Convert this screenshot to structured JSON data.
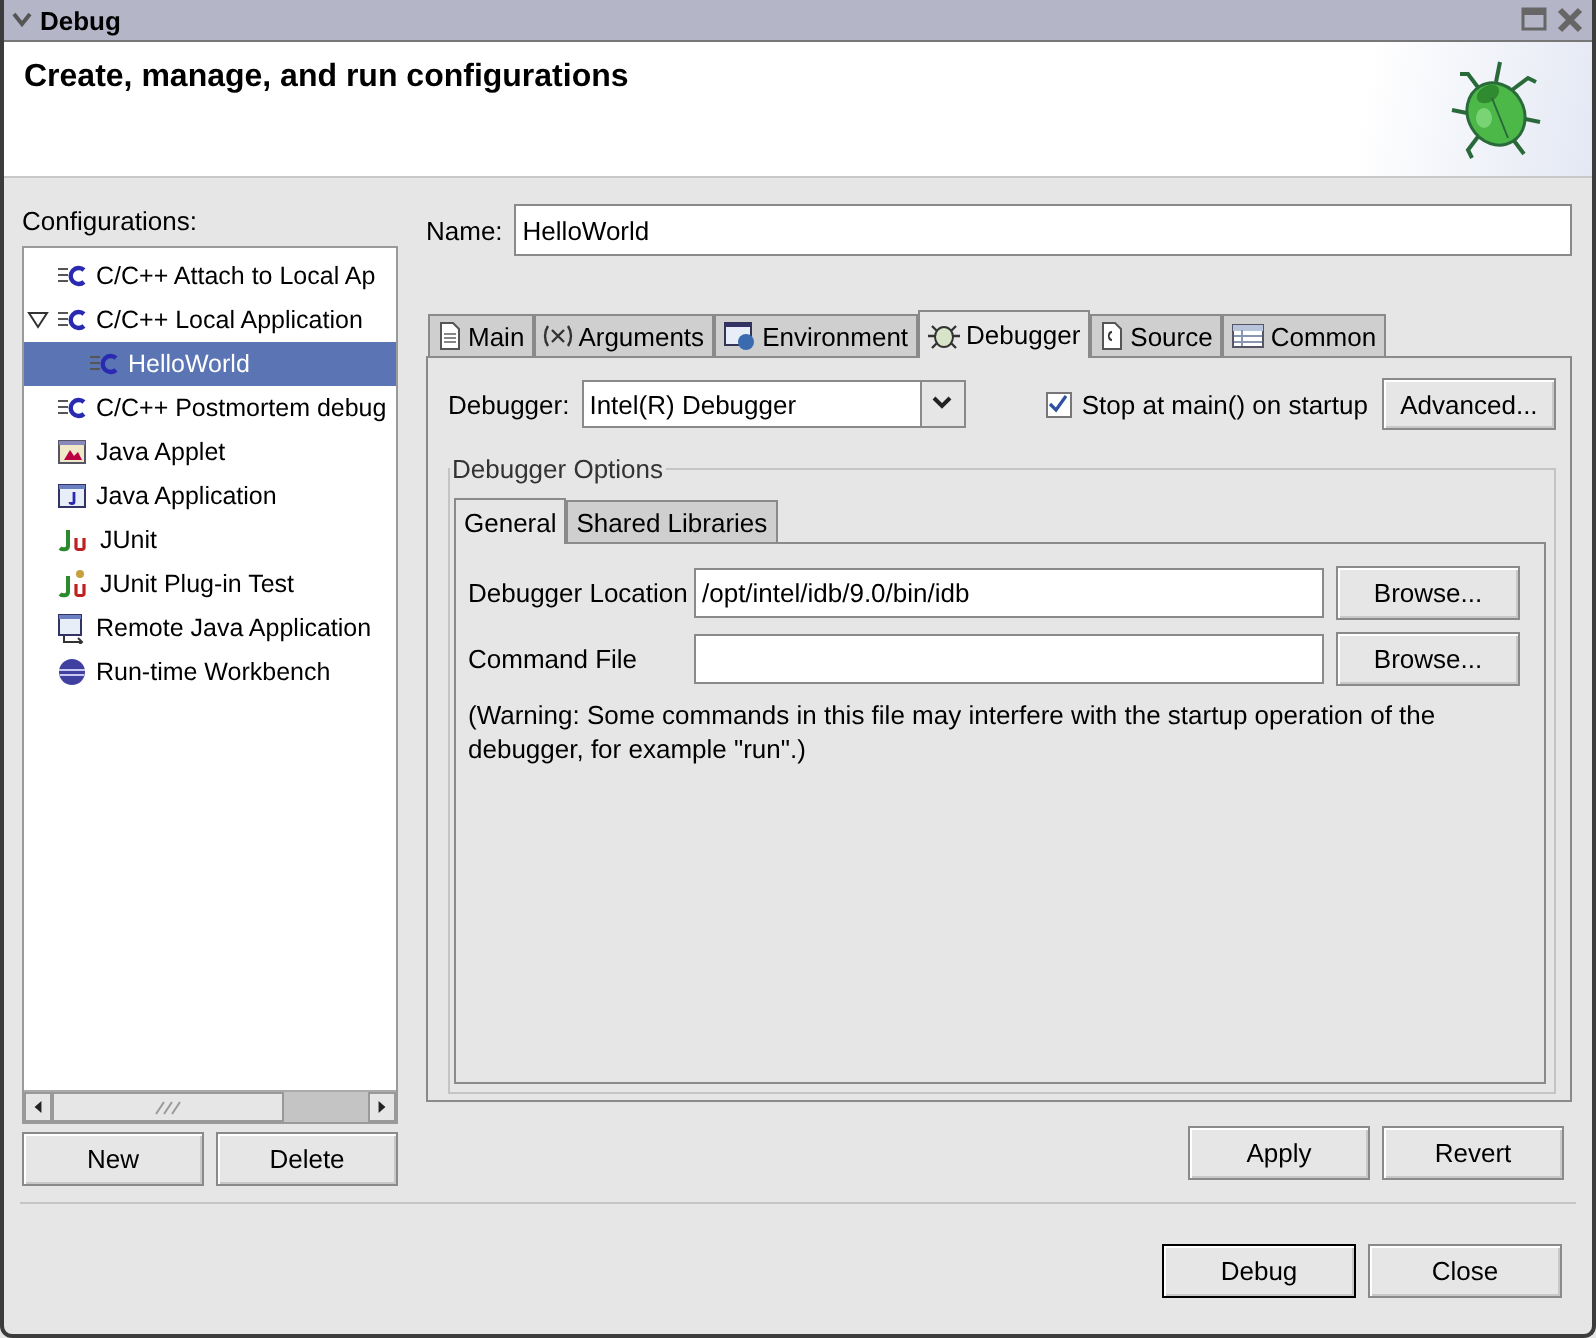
{
  "window": {
    "title": "Debug"
  },
  "header": {
    "title": "Create, manage, and run configurations"
  },
  "configurations": {
    "label": "Configurations:",
    "items": [
      {
        "label": "C/C++ Attach to Local Ap",
        "kind": "cpp",
        "selected": false
      },
      {
        "label": "C/C++ Local Application",
        "kind": "cpp",
        "selected": false,
        "expanded": true,
        "children": [
          {
            "label": "HelloWorld",
            "kind": "cpp",
            "selected": true
          }
        ]
      },
      {
        "label": "C/C++ Postmortem debug",
        "kind": "cpp",
        "selected": false
      },
      {
        "label": "Java Applet",
        "kind": "applet",
        "selected": false
      },
      {
        "label": "Java Application",
        "kind": "java",
        "selected": false
      },
      {
        "label": "JUnit",
        "kind": "junit",
        "selected": false
      },
      {
        "label": "JUnit Plug-in Test",
        "kind": "junit-plugin",
        "selected": false
      },
      {
        "label": "Remote Java Application",
        "kind": "remote",
        "selected": false
      },
      {
        "label": "Run-time Workbench",
        "kind": "workbench",
        "selected": false
      }
    ]
  },
  "config_buttons": [
    {
      "label": "New"
    },
    {
      "label": "Delete"
    }
  ],
  "name": {
    "label": "Name:",
    "value": "HelloWorld"
  },
  "tabs": [
    {
      "label": "Main",
      "kind": "main",
      "selected": false
    },
    {
      "label": "Arguments",
      "kind": "arguments",
      "selected": false
    },
    {
      "label": "Environment",
      "kind": "environment",
      "selected": false
    },
    {
      "label": "Debugger",
      "kind": "debugger",
      "selected": true
    },
    {
      "label": "Source",
      "kind": "source",
      "selected": false
    },
    {
      "label": "Common",
      "kind": "common",
      "selected": false
    }
  ],
  "debugger": {
    "label": "Debugger:",
    "value": "Intel(R) Debugger"
  },
  "stop_at_main": {
    "label": "Stop at main() on startup",
    "checked": true
  },
  "advanced_button": {
    "label": "Advanced..."
  },
  "options": {
    "title": "Debugger Options",
    "tabs": [
      {
        "label": "General",
        "selected": true
      },
      {
        "label": "Shared Libraries",
        "selected": false
      }
    ],
    "fields": [
      {
        "label": "Debugger Location",
        "value": "/opt/intel/idb/9.0/bin/idb",
        "button": {
          "label": "Browse..."
        }
      },
      {
        "label": "Command File",
        "button": {
          "label": "Browse..."
        }
      }
    ],
    "warning": "(Warning: Some commands in this file may interfere with the startup operation of the debugger, for example \"run\".)"
  },
  "edit_buttons": [
    {
      "label": "Apply"
    },
    {
      "label": "Revert"
    }
  ],
  "dialog_buttons": [
    {
      "label": "Debug"
    },
    {
      "label": "Close"
    }
  ]
}
